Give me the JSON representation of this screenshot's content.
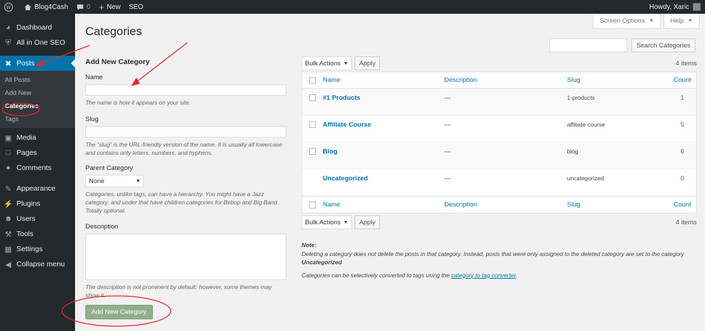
{
  "admin_bar": {
    "site_name": "Blog4Cash",
    "comments_count": "0",
    "new_label": "New",
    "seo_label": "SEO",
    "howdy": "Howdy, Xaric"
  },
  "sidebar": {
    "dashboard": "Dashboard",
    "seo": "All in One SEO",
    "posts": "Posts",
    "posts_sub": [
      "All Posts",
      "Add New",
      "Categories",
      "Tags"
    ],
    "media": "Media",
    "pages": "Pages",
    "comments": "Comments",
    "appearance": "Appearance",
    "plugins": "Plugins",
    "users": "Users",
    "tools": "Tools",
    "settings": "Settings",
    "collapse": "Collapse menu"
  },
  "screen_options": "Screen Options",
  "help": "Help",
  "page_title": "Categories",
  "form": {
    "title": "Add New Category",
    "name_label": "Name",
    "name_help": "The name is how it appears on your site.",
    "slug_label": "Slug",
    "slug_help": "The “slug” is the URL-friendly version of the name. It is usually all lowercase and contains only letters, numbers, and hyphens.",
    "parent_label": "Parent Category",
    "parent_value": "None",
    "parent_help": "Categories, unlike tags, can have a hierarchy. You might have a Jazz category, and under that have children categories for Bebop and Big Band. Totally optional.",
    "description_label": "Description",
    "description_help": "The description is not prominent by default; however, some themes may show it.",
    "submit": "Add New Category"
  },
  "search_button": "Search Categories",
  "bulk_actions": "Bulk Actions",
  "apply": "Apply",
  "items_count": "4 items",
  "table": {
    "headers": {
      "name": "Name",
      "description": "Description",
      "slug": "Slug",
      "count": "Count"
    },
    "rows": [
      {
        "name": "#1 Products",
        "description": "—",
        "slug": "1-products",
        "count": "1"
      },
      {
        "name": "Affiliate Course",
        "description": "—",
        "slug": "affiliate-course",
        "count": "5"
      },
      {
        "name": "Blog",
        "description": "—",
        "slug": "blog",
        "count": "6"
      },
      {
        "name": "Uncategorized",
        "description": "—",
        "slug": "uncategorized",
        "count": "0"
      }
    ]
  },
  "note": {
    "title": "Note:",
    "text1": "Deleting a category does not delete the posts in that category. Instead, posts that were only assigned to the deleted category are set to the category",
    "uncategorized": "Uncategorized",
    "text2_pre": "Categories can be selectively converted to tags using the",
    "link": "category to tag converter",
    "text2_post": "."
  },
  "colors": {
    "accent": "#0073aa",
    "sidebar": "#23282d",
    "annotation": "#e8262b"
  }
}
